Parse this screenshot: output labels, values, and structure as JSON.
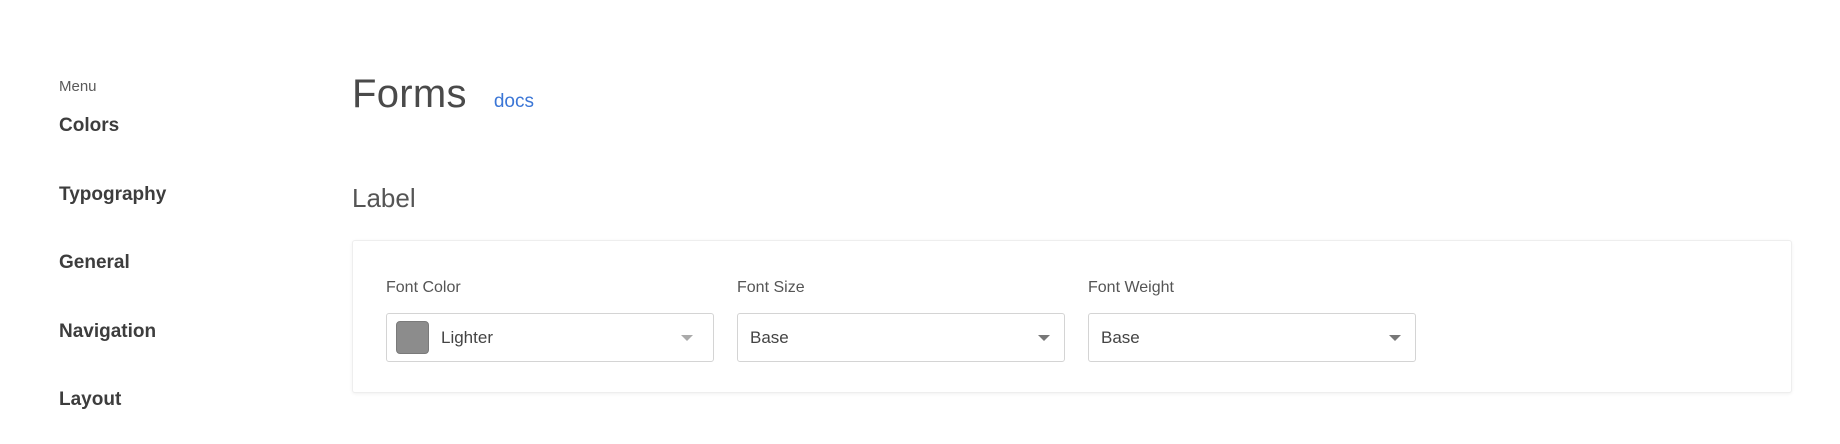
{
  "sidebar": {
    "heading": "Menu",
    "items": [
      {
        "label": "Colors"
      },
      {
        "label": "Typography"
      },
      {
        "label": "General"
      },
      {
        "label": "Navigation"
      },
      {
        "label": "Layout"
      }
    ]
  },
  "main": {
    "title": "Forms",
    "docs_link": "docs",
    "section_title": "Label",
    "fields": [
      {
        "label": "Font Color",
        "value": "Lighter",
        "swatch_color": "#8c8c8c",
        "icon": "chevron-down-icon"
      },
      {
        "label": "Font Size",
        "value": "Base",
        "icon": "chevron-down-icon"
      },
      {
        "label": "Font Weight",
        "value": "Base",
        "icon": "chevron-down-icon"
      }
    ]
  },
  "colors": {
    "link": "#3b76d6",
    "swatch": "#8c8c8c"
  }
}
